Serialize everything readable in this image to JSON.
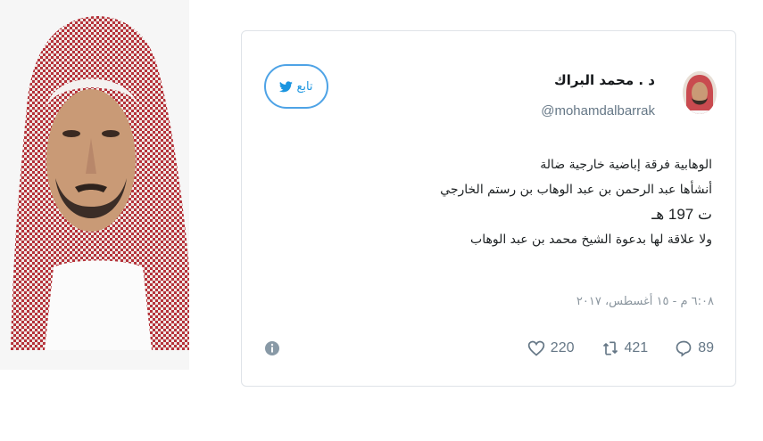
{
  "tweet": {
    "display_name": "د . محمد البراك",
    "handle": "@mohamdalbarrak",
    "follow_label": "تابع",
    "lines": [
      "الوهابية فرقة إباضية خارجية ضالة",
      "أنشأها عبد الرحمن بن عبد الوهاب بن رستم الخارجي",
      "ت 197 هـ",
      "ولا علاقة لها بدعوة الشيخ محمد بن عبد الوهاب"
    ],
    "timestamp": "٦:٠٨ م - ١٥ أغسطس، ٢٠١٧",
    "replies": "89",
    "retweets": "421",
    "likes": "220"
  },
  "colors": {
    "twitter_blue": "#1b95e0",
    "text": "#1c2022",
    "muted": "#657786",
    "shemagh_red": "#b5323a"
  },
  "icons": [
    "twitter-bird-icon",
    "reply-icon",
    "retweet-icon",
    "heart-icon",
    "info-icon"
  ]
}
